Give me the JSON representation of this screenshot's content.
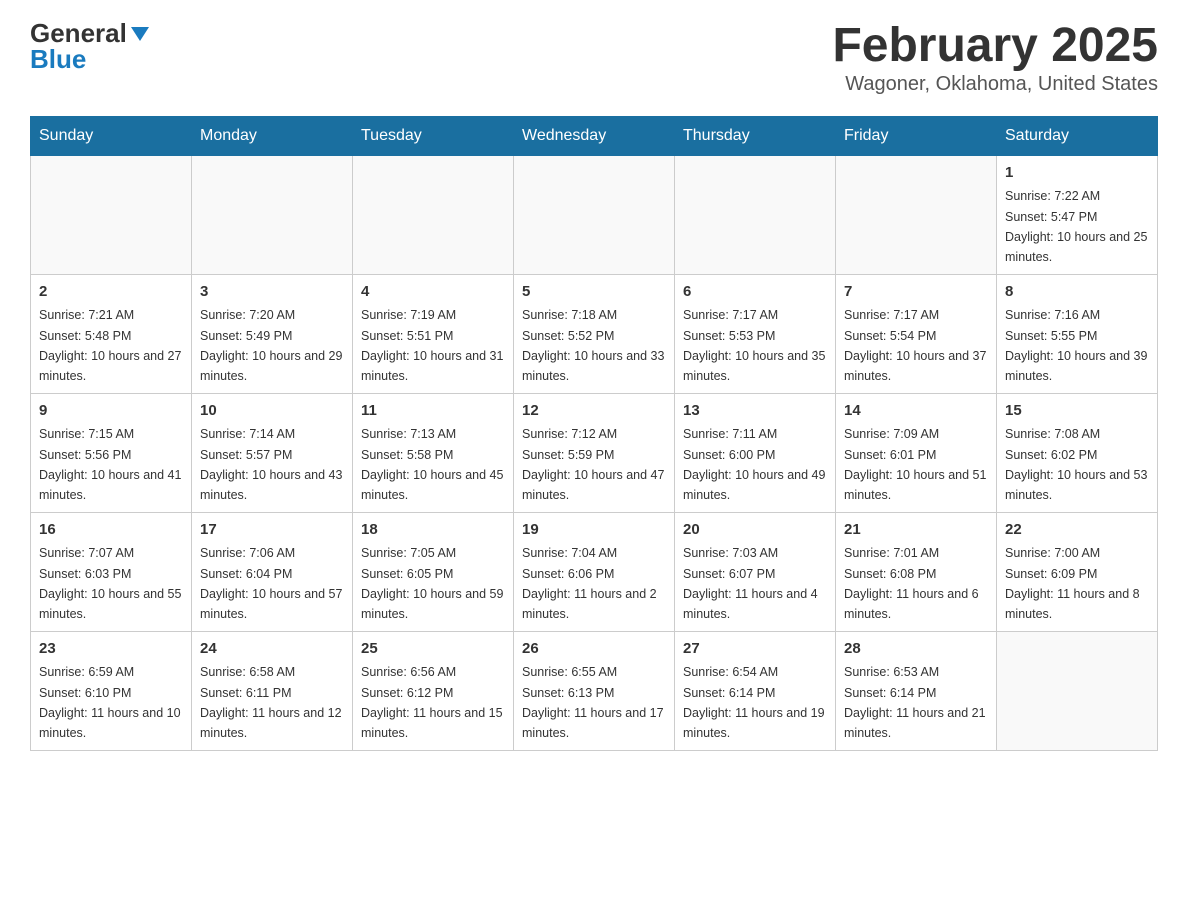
{
  "header": {
    "logo_general": "General",
    "logo_blue": "Blue",
    "title": "February 2025",
    "subtitle": "Wagoner, Oklahoma, United States"
  },
  "days_of_week": [
    "Sunday",
    "Monday",
    "Tuesday",
    "Wednesday",
    "Thursday",
    "Friday",
    "Saturday"
  ],
  "weeks": [
    [
      {
        "day": "",
        "info": ""
      },
      {
        "day": "",
        "info": ""
      },
      {
        "day": "",
        "info": ""
      },
      {
        "day": "",
        "info": ""
      },
      {
        "day": "",
        "info": ""
      },
      {
        "day": "",
        "info": ""
      },
      {
        "day": "1",
        "info": "Sunrise: 7:22 AM\nSunset: 5:47 PM\nDaylight: 10 hours and 25 minutes."
      }
    ],
    [
      {
        "day": "2",
        "info": "Sunrise: 7:21 AM\nSunset: 5:48 PM\nDaylight: 10 hours and 27 minutes."
      },
      {
        "day": "3",
        "info": "Sunrise: 7:20 AM\nSunset: 5:49 PM\nDaylight: 10 hours and 29 minutes."
      },
      {
        "day": "4",
        "info": "Sunrise: 7:19 AM\nSunset: 5:51 PM\nDaylight: 10 hours and 31 minutes."
      },
      {
        "day": "5",
        "info": "Sunrise: 7:18 AM\nSunset: 5:52 PM\nDaylight: 10 hours and 33 minutes."
      },
      {
        "day": "6",
        "info": "Sunrise: 7:17 AM\nSunset: 5:53 PM\nDaylight: 10 hours and 35 minutes."
      },
      {
        "day": "7",
        "info": "Sunrise: 7:17 AM\nSunset: 5:54 PM\nDaylight: 10 hours and 37 minutes."
      },
      {
        "day": "8",
        "info": "Sunrise: 7:16 AM\nSunset: 5:55 PM\nDaylight: 10 hours and 39 minutes."
      }
    ],
    [
      {
        "day": "9",
        "info": "Sunrise: 7:15 AM\nSunset: 5:56 PM\nDaylight: 10 hours and 41 minutes."
      },
      {
        "day": "10",
        "info": "Sunrise: 7:14 AM\nSunset: 5:57 PM\nDaylight: 10 hours and 43 minutes."
      },
      {
        "day": "11",
        "info": "Sunrise: 7:13 AM\nSunset: 5:58 PM\nDaylight: 10 hours and 45 minutes."
      },
      {
        "day": "12",
        "info": "Sunrise: 7:12 AM\nSunset: 5:59 PM\nDaylight: 10 hours and 47 minutes."
      },
      {
        "day": "13",
        "info": "Sunrise: 7:11 AM\nSunset: 6:00 PM\nDaylight: 10 hours and 49 minutes."
      },
      {
        "day": "14",
        "info": "Sunrise: 7:09 AM\nSunset: 6:01 PM\nDaylight: 10 hours and 51 minutes."
      },
      {
        "day": "15",
        "info": "Sunrise: 7:08 AM\nSunset: 6:02 PM\nDaylight: 10 hours and 53 minutes."
      }
    ],
    [
      {
        "day": "16",
        "info": "Sunrise: 7:07 AM\nSunset: 6:03 PM\nDaylight: 10 hours and 55 minutes."
      },
      {
        "day": "17",
        "info": "Sunrise: 7:06 AM\nSunset: 6:04 PM\nDaylight: 10 hours and 57 minutes."
      },
      {
        "day": "18",
        "info": "Sunrise: 7:05 AM\nSunset: 6:05 PM\nDaylight: 10 hours and 59 minutes."
      },
      {
        "day": "19",
        "info": "Sunrise: 7:04 AM\nSunset: 6:06 PM\nDaylight: 11 hours and 2 minutes."
      },
      {
        "day": "20",
        "info": "Sunrise: 7:03 AM\nSunset: 6:07 PM\nDaylight: 11 hours and 4 minutes."
      },
      {
        "day": "21",
        "info": "Sunrise: 7:01 AM\nSunset: 6:08 PM\nDaylight: 11 hours and 6 minutes."
      },
      {
        "day": "22",
        "info": "Sunrise: 7:00 AM\nSunset: 6:09 PM\nDaylight: 11 hours and 8 minutes."
      }
    ],
    [
      {
        "day": "23",
        "info": "Sunrise: 6:59 AM\nSunset: 6:10 PM\nDaylight: 11 hours and 10 minutes."
      },
      {
        "day": "24",
        "info": "Sunrise: 6:58 AM\nSunset: 6:11 PM\nDaylight: 11 hours and 12 minutes."
      },
      {
        "day": "25",
        "info": "Sunrise: 6:56 AM\nSunset: 6:12 PM\nDaylight: 11 hours and 15 minutes."
      },
      {
        "day": "26",
        "info": "Sunrise: 6:55 AM\nSunset: 6:13 PM\nDaylight: 11 hours and 17 minutes."
      },
      {
        "day": "27",
        "info": "Sunrise: 6:54 AM\nSunset: 6:14 PM\nDaylight: 11 hours and 19 minutes."
      },
      {
        "day": "28",
        "info": "Sunrise: 6:53 AM\nSunset: 6:14 PM\nDaylight: 11 hours and 21 minutes."
      },
      {
        "day": "",
        "info": ""
      }
    ]
  ]
}
